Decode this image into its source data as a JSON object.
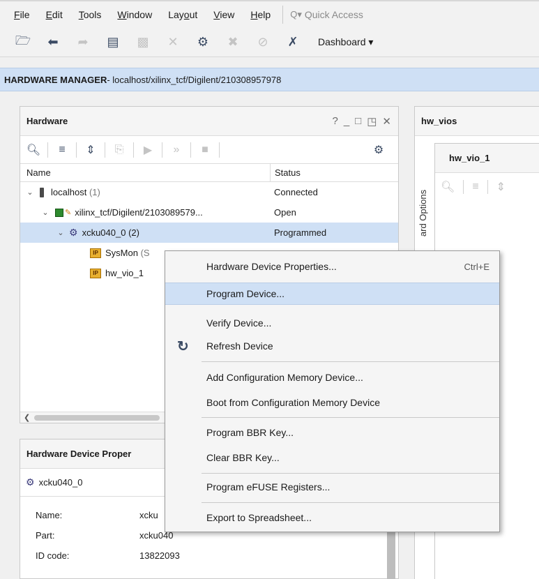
{
  "menubar": {
    "items": [
      "File",
      "Edit",
      "Tools",
      "Window",
      "Layout",
      "View",
      "Help"
    ],
    "underline": [
      "F",
      "E",
      "T",
      "W",
      "o",
      "V",
      "H"
    ],
    "quick_access_placeholder": "Quick Access"
  },
  "toolbar": {
    "icons": [
      "open-project-icon",
      "undo-icon",
      "redo-icon",
      "report-icon",
      "paste-icon",
      "delete-icon",
      "settings-icon",
      "auto-connect-icon",
      "disable-icon",
      "close-x-icon"
    ],
    "dashboard_label": "Dashboard"
  },
  "banner": {
    "title": "HARDWARE MANAGER",
    "path": " - localhost/xilinx_tcf/Digilent/210308957978"
  },
  "hardware_panel": {
    "title": "Hardware",
    "controls": [
      "?",
      "_",
      "□",
      "◳",
      "✕"
    ],
    "columns": [
      "Name",
      "Status"
    ],
    "rows": [
      {
        "name": "localhost",
        "count": "(1)",
        "status": "Connected"
      },
      {
        "name": "xilinx_tcf/Digilent/2103089579...",
        "count": "",
        "status": "Open"
      },
      {
        "name": "xcku040_0",
        "count": "(2)",
        "status": "Programmed"
      },
      {
        "name": "SysMon",
        "count": "(S",
        "status": ""
      },
      {
        "name": "hw_vio_1",
        "count": "",
        "status": ""
      }
    ]
  },
  "props_panel": {
    "title": "Hardware Device Proper",
    "device": "xcku040_0",
    "fields": [
      {
        "k": "Name:",
        "v": "xcku"
      },
      {
        "k": "Part:",
        "v": "xcku040"
      },
      {
        "k": "ID code:",
        "v": "13822093"
      }
    ]
  },
  "vios_panel": {
    "title": "hw_vios",
    "inner_tab": "hw_vio_1",
    "side_tab": "ard Options"
  },
  "context_menu": {
    "items": [
      {
        "label": "Hardware Device Properties...",
        "accel": "Ctrl+E"
      },
      {
        "label": "Program Device..."
      },
      {
        "label": "Verify Device..."
      },
      {
        "label": "Refresh Device"
      },
      {
        "label": "Add Configuration Memory Device..."
      },
      {
        "label": "Boot from Configuration Memory Device"
      },
      {
        "label": "Program BBR Key..."
      },
      {
        "label": "Clear BBR Key..."
      },
      {
        "label": "Program eFUSE Registers..."
      },
      {
        "label": "Export to Spreadsheet..."
      }
    ],
    "highlighted_index": 1
  },
  "colors": {
    "selection": "#cfe0f5",
    "banner": "#cfe0f5",
    "icon_dark": "#3a4a63"
  }
}
